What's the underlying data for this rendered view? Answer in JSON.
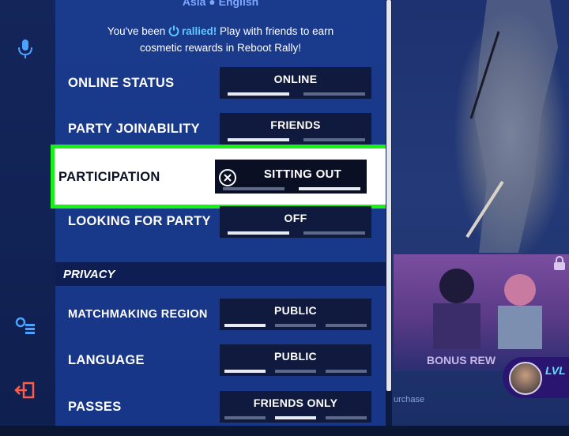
{
  "header": {
    "language_partial": "Asia ● English",
    "rally_prefix": "You've been ",
    "rally_highlight": "rallied!",
    "rally_suffix": " Play with friends to earn",
    "rally_line2": "cosmetic rewards in Reboot Rally!"
  },
  "settings": [
    {
      "label": "ONLINE STATUS",
      "value": "ONLINE"
    },
    {
      "label": "PARTY JOINABILITY",
      "value": "FRIENDS"
    },
    {
      "label": "PARTICIPATION",
      "value": "SITTING OUT"
    },
    {
      "label": "LOOKING FOR PARTY",
      "value": "OFF"
    }
  ],
  "privacy": {
    "heading": "PRIVACY",
    "settings": [
      {
        "label": "MATCHMAKING REGION",
        "value": "PUBLIC"
      },
      {
        "label": "LANGUAGE",
        "value": "PUBLIC"
      },
      {
        "label": "PASSES",
        "value": "FRIENDS ONLY"
      }
    ]
  },
  "side": {
    "bonus_label": "BONUS REW",
    "lvl_label": "LVL",
    "purchase_fragment": "urchase"
  },
  "icons": {
    "rally": "power-icon",
    "clear": "x-circle-icon",
    "mic": "microphone-icon",
    "settings": "settings-list-icon",
    "exit": "exit-icon",
    "lock": "lock-icon"
  },
  "colors": {
    "highlight": "#19f01a",
    "panel": "#1a3a8c",
    "selector": "#101a3e",
    "rally_accent": "#5fc8ff"
  }
}
